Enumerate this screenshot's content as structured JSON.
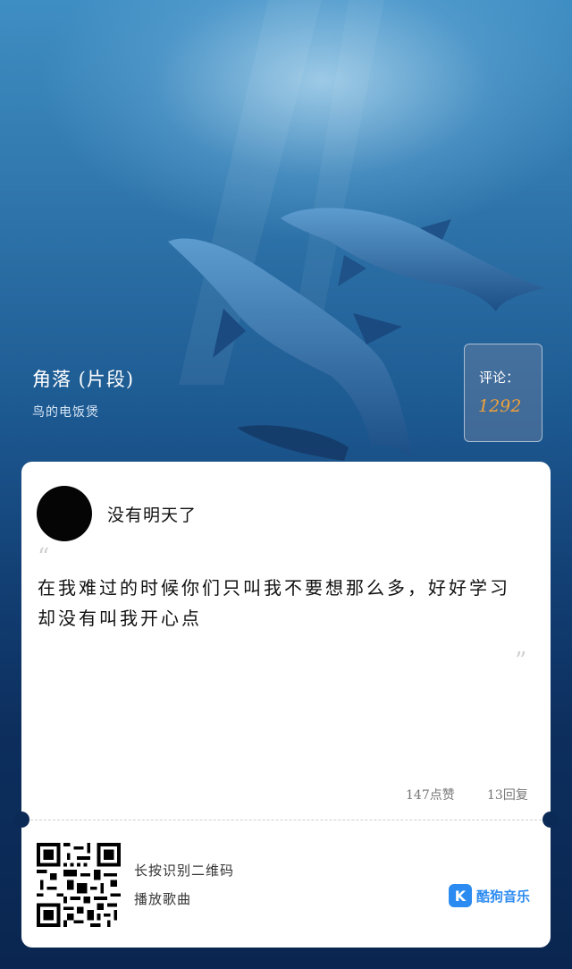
{
  "song": {
    "title": "角落 (片段)",
    "artist": "鸟的电饭煲"
  },
  "comments": {
    "label": "评论：",
    "count": "1292"
  },
  "card": {
    "username": "没有明天了",
    "quote_open": "“",
    "quote_close": "”",
    "lines": [
      "在我难过的时候你们只叫我不要想那么多，好好学习",
      "却没有叫我开心点"
    ],
    "likes": "147点赞",
    "replies": "13回复"
  },
  "footer": {
    "qr_hint_1": "长按识别二维码",
    "qr_hint_2": "播放歌曲",
    "brand_logo_letter": "K",
    "brand_name": "酷狗音乐",
    "brand_color": "#2c8bf0"
  }
}
